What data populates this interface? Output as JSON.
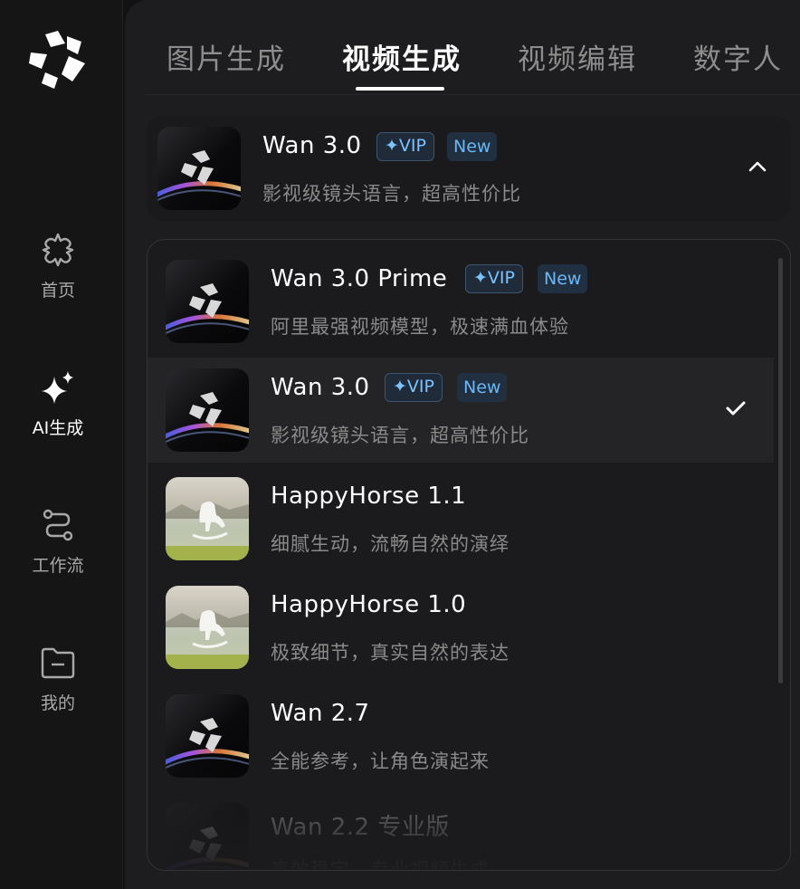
{
  "sidebar": {
    "items": [
      {
        "label": "首页",
        "icon": "home-icon"
      },
      {
        "label": "AI生成",
        "icon": "sparkle-icon"
      },
      {
        "label": "工作流",
        "icon": "workflow-icon"
      },
      {
        "label": "我的",
        "icon": "folder-icon"
      }
    ]
  },
  "tabs": [
    {
      "label": "图片生成"
    },
    {
      "label": "视频生成"
    },
    {
      "label": "视频编辑"
    },
    {
      "label": "数字人"
    }
  ],
  "selected_model": {
    "name": "Wan 3.0",
    "vip": "✦VIP",
    "new": "New",
    "desc": "影视级镜头语言，超高性价比"
  },
  "models": [
    {
      "name": "Wan 3.0 Prime",
      "vip": "✦VIP",
      "new": "New",
      "desc": "阿里最强视频模型，极速满血体验"
    },
    {
      "name": "Wan 3.0",
      "vip": "✦VIP",
      "new": "New",
      "desc": "影视级镜头语言，超高性价比"
    },
    {
      "name": "HappyHorse 1.1",
      "desc": "细腻生动，流畅自然的演绎"
    },
    {
      "name": "HappyHorse 1.0",
      "desc": "极致细节，真实自然的表达"
    },
    {
      "name": "Wan 2.7",
      "desc": "全能参考，让角色演起来"
    },
    {
      "name": "Wan 2.2 专业版",
      "desc": "高效稳定，专业视频生成"
    }
  ],
  "colors": {
    "accent_vip": "#7cc2ff",
    "background": "#121212",
    "panel": "#1d1d1f"
  }
}
